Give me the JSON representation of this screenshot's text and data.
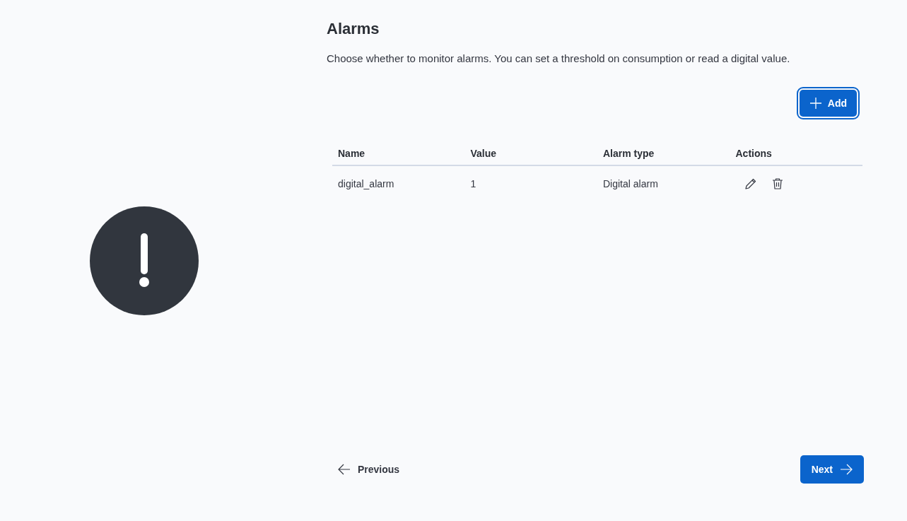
{
  "title": "Alarms",
  "description": "Choose whether to monitor alarms. You can set a threshold on consumption or read a digital value.",
  "add_button": {
    "label": "Add",
    "focused": true
  },
  "table": {
    "columns": [
      "Name",
      "Value",
      "Alarm type",
      "Actions"
    ],
    "rows": [
      {
        "name": "digital_alarm",
        "value": "1",
        "alarm_type": "Digital alarm"
      }
    ]
  },
  "footer": {
    "previous": "Previous",
    "next": "Next"
  }
}
